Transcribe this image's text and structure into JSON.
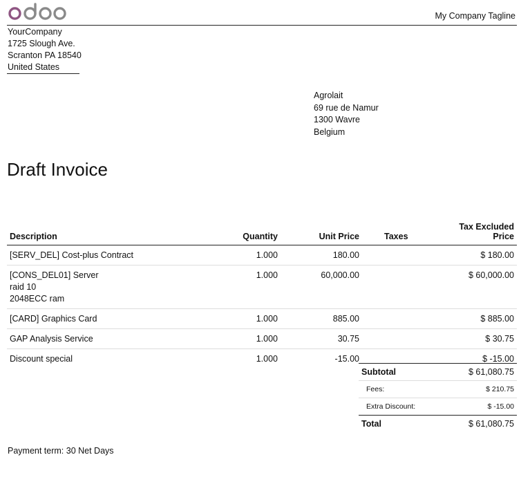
{
  "header": {
    "logo_text": "odoo",
    "logo_color": "#8f5683",
    "logo_gray": "#8a8a8a",
    "tagline": "My Company Tagline"
  },
  "company": {
    "name": "YourCompany",
    "street": "1725 Slough Ave.",
    "city": "Scranton PA 18540",
    "country": "United States"
  },
  "partner": {
    "name": "Agrolait",
    "street": "69 rue de Namur",
    "city": "1300 Wavre",
    "country": "Belgium"
  },
  "document": {
    "title": "Draft Invoice"
  },
  "lines_table": {
    "headers": {
      "description": "Description",
      "quantity": "Quantity",
      "unit_price": "Unit Price",
      "taxes": "Taxes",
      "total": "Tax Excluded Price"
    },
    "rows": [
      {
        "description": [
          "[SERV_DEL] Cost-plus Contract"
        ],
        "quantity": "1.000",
        "unit_price": "180.00",
        "taxes": "",
        "total": "$ 180.00"
      },
      {
        "description": [
          "[CONS_DEL01] Server",
          "raid 10",
          "2048ECC ram"
        ],
        "quantity": "1.000",
        "unit_price": "60,000.00",
        "taxes": "",
        "total": "$ 60,000.00"
      },
      {
        "description": [
          "[CARD] Graphics Card"
        ],
        "quantity": "1.000",
        "unit_price": "885.00",
        "taxes": "",
        "total": "$ 885.00"
      },
      {
        "description": [
          "GAP Analysis Service"
        ],
        "quantity": "1.000",
        "unit_price": "30.75",
        "taxes": "",
        "total": "$ 30.75"
      },
      {
        "description": [
          "Discount special"
        ],
        "quantity": "1.000",
        "unit_price": "-15.00",
        "taxes": "",
        "total": "$ -15.00"
      }
    ]
  },
  "totals": {
    "subtotal_label": "Subtotal",
    "subtotal_value": "$ 61,080.75",
    "fees_label": "Fees:",
    "fees_value": "$ 210.75",
    "extra_discount_label": "Extra Discount:",
    "extra_discount_value": "$ -15.00",
    "total_label": "Total",
    "total_value": "$ 61,080.75"
  },
  "payment": {
    "term": "Payment term: 30 Net Days"
  }
}
